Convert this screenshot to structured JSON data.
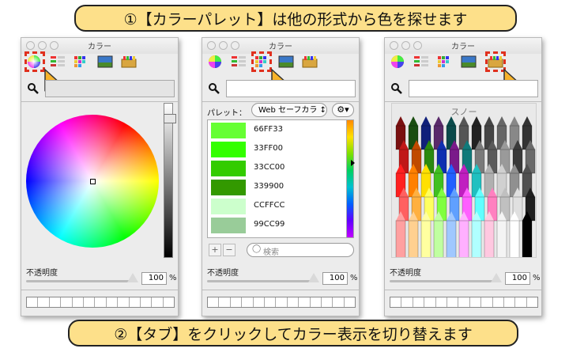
{
  "banner_top": "①【カラーパレット】は他の形式から色を探せます",
  "banner_bottom": "②【タブ】をクリックしてカラー表示を切り替えます",
  "panels": [
    {
      "title": "カラー",
      "opacity_label": "不透明度",
      "opacity_value": "100",
      "opacity_unit": "%",
      "active_tab": "color-wheel"
    },
    {
      "title": "カラー",
      "opacity_label": "不透明度",
      "opacity_value": "100",
      "opacity_unit": "%",
      "active_tab": "palettes",
      "palette_label": "パレット：",
      "palette_select": "Web セーフカラ ↕",
      "colors": [
        {
          "name": "66FF33",
          "hex": "#66FF33"
        },
        {
          "name": "33FF00",
          "hex": "#33FF00"
        },
        {
          "name": "33CC00",
          "hex": "#33CC00"
        },
        {
          "name": "339900",
          "hex": "#339900"
        },
        {
          "name": "CCFFCC",
          "hex": "#CCFFCC"
        },
        {
          "name": "99CC99",
          "hex": "#99CC99"
        }
      ],
      "add_label": "+",
      "remove_label": "−",
      "search_placeholder": "検索"
    },
    {
      "title": "カラー",
      "opacity_label": "不透明度",
      "opacity_value": "100",
      "opacity_unit": "%",
      "active_tab": "crayons",
      "crayon_name": "スノー"
    }
  ],
  "colors": {
    "banner_bg": "#fde08a",
    "highlight": "#e0301e",
    "cursor": "#f7b32b"
  }
}
